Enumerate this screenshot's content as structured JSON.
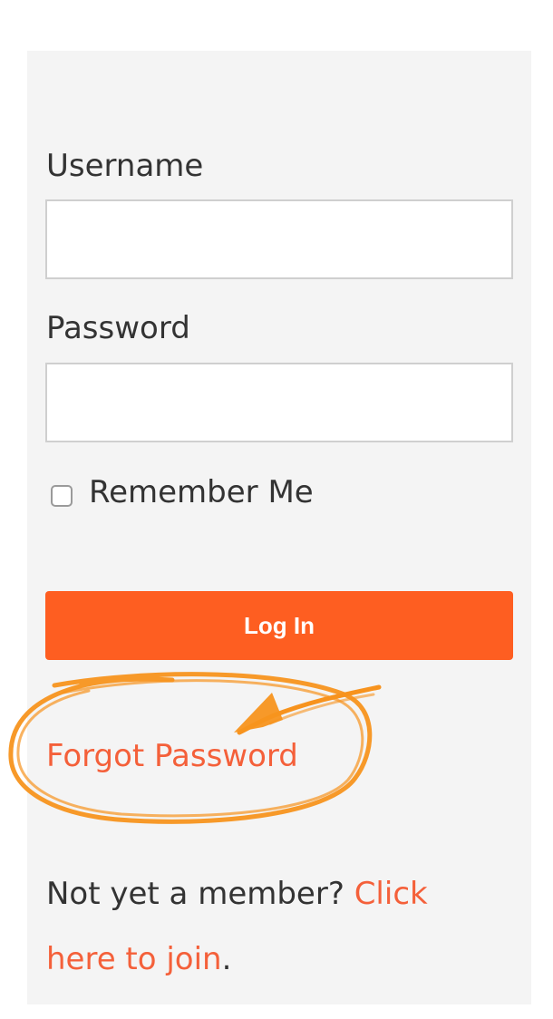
{
  "login_form": {
    "username_label": "Username",
    "username_value": "",
    "password_label": "Password",
    "password_value": "",
    "remember_label": "Remember Me",
    "remember_checked": false,
    "login_button_label": "Log In",
    "forgot_password_label": "Forgot Password",
    "join_prompt": "Not yet a member? ",
    "join_link_label": "Click here to join",
    "join_suffix": "."
  },
  "colors": {
    "panel_background": "#f4f4f4",
    "accent": "#fe5e21",
    "link": "#f4603a",
    "annotation": "#f7931e",
    "text": "#333333"
  },
  "icons": {
    "annotation": "orange-hand-drawn-circle-with-arrow"
  }
}
